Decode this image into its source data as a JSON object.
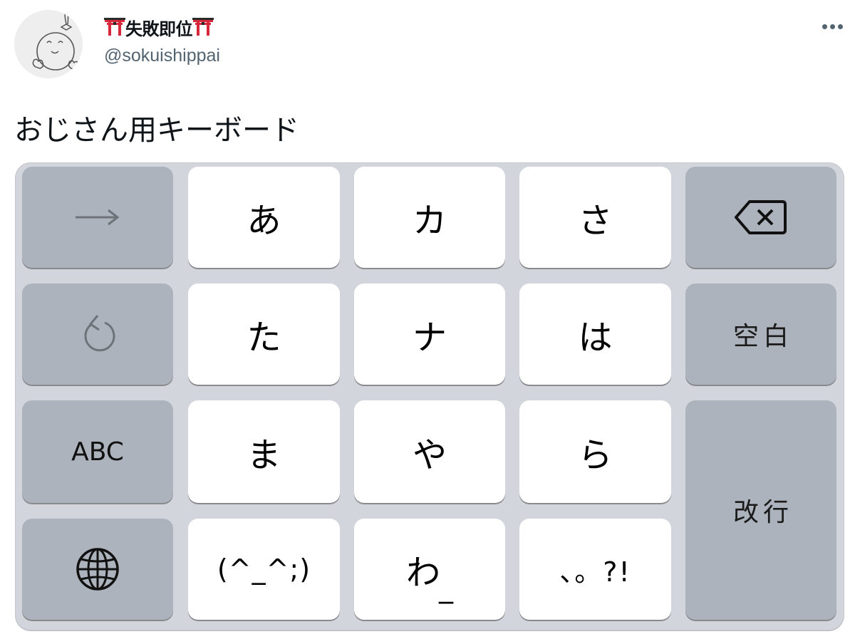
{
  "tweet": {
    "author": {
      "display_name": "失敗即位",
      "display_name_prefix_emoji": "torii-gate",
      "display_name_suffix_emoji": "torii-gate",
      "handle": "@sokuishippai",
      "avatar": "hand-drawn-baby-face"
    },
    "more_menu_icon": "more-horizontal-icon",
    "text": "おじさん用キーボード"
  },
  "keyboard": {
    "rows": [
      [
        {
          "type": "func",
          "icon": "arrow-right-icon",
          "label": "→"
        },
        {
          "type": "char",
          "label": "あ"
        },
        {
          "type": "char",
          "label": "カ"
        },
        {
          "type": "char",
          "label": "さ"
        },
        {
          "type": "func",
          "icon": "backspace-icon",
          "label": ""
        }
      ],
      [
        {
          "type": "func",
          "icon": "undo-icon",
          "label": ""
        },
        {
          "type": "char",
          "label": "た"
        },
        {
          "type": "char",
          "label": "ナ"
        },
        {
          "type": "char",
          "label": "は"
        },
        {
          "type": "func",
          "label": "空白"
        }
      ],
      [
        {
          "type": "func",
          "label": "ABC"
        },
        {
          "type": "char",
          "label": "ま"
        },
        {
          "type": "char",
          "label": "や"
        },
        {
          "type": "char",
          "label": "ら"
        },
        {
          "type": "func",
          "label": "改行"
        }
      ],
      [
        {
          "type": "func",
          "icon": "globe-icon",
          "label": ""
        },
        {
          "type": "char",
          "label": "(^_^;)"
        },
        {
          "type": "char",
          "label": "わ",
          "suffix": "_"
        },
        {
          "type": "char",
          "label": "、。?!"
        }
      ]
    ],
    "colors": {
      "background": "#d2d5db",
      "char_key": "#ffffff",
      "func_key": "#adb3bc",
      "key_shadow": "#898a8d"
    }
  }
}
